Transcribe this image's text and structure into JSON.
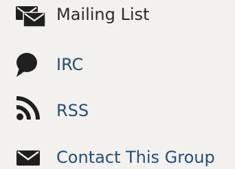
{
  "colors": {
    "background": "#f2f1ee",
    "icon": "#1f1f1f",
    "link": "#234e78",
    "text": "#2b2b2b"
  },
  "links": {
    "mailing_list": {
      "label": "Mailing List",
      "icon": "envelopes-icon"
    },
    "irc": {
      "label": "IRC",
      "icon": "speech-bubble-icon"
    },
    "rss": {
      "label": "RSS",
      "icon": "rss-feed-icon"
    },
    "contact": {
      "label": "Contact This Group",
      "icon": "envelope-icon"
    }
  }
}
